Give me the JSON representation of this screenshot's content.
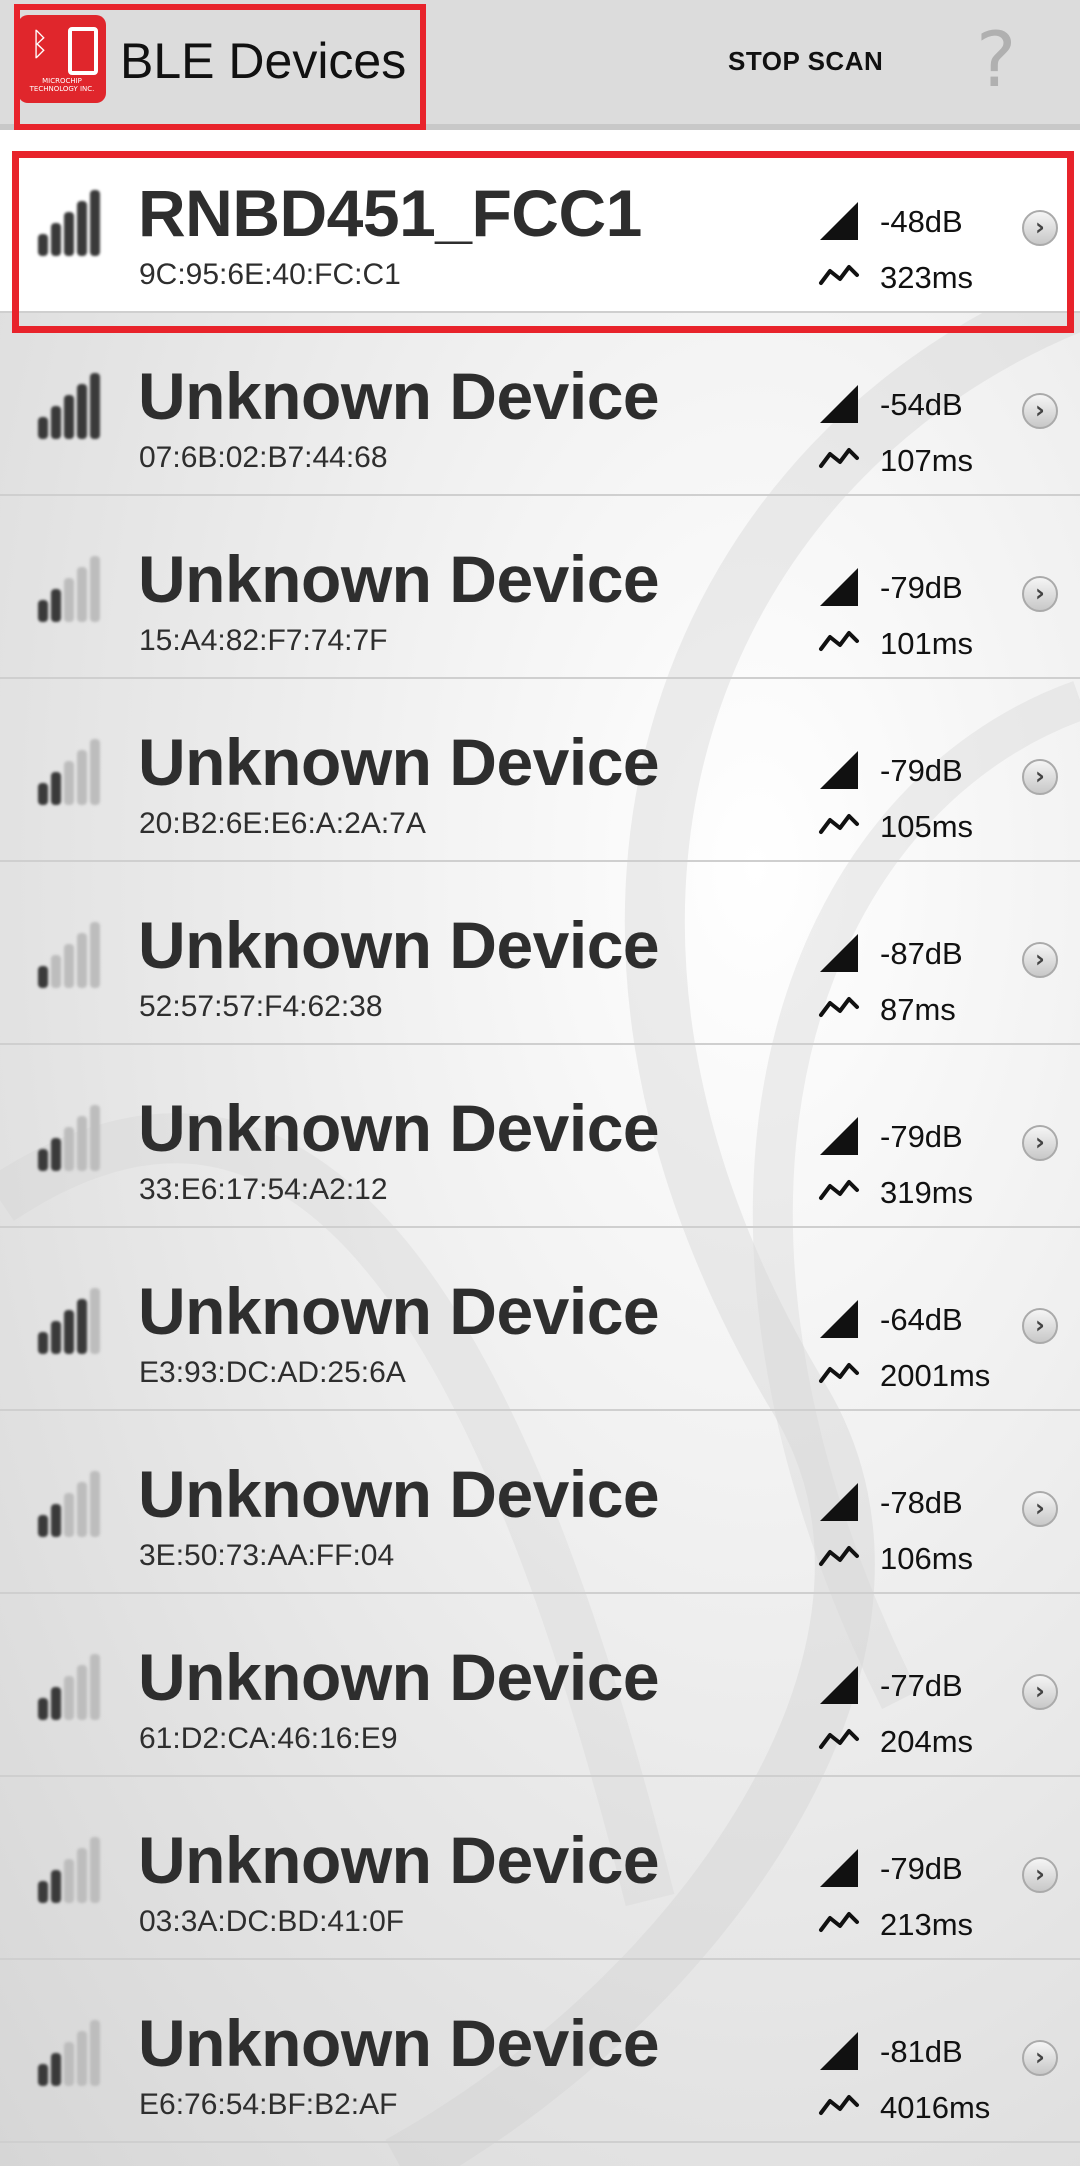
{
  "header": {
    "title": "BLE Devices",
    "logo_text": "MICROCHIP TECHNOLOGY INC.",
    "stop_scan_label": "STOP SCAN",
    "help_glyph": "?"
  },
  "devices": [
    {
      "name": "RNBD451_FCC1",
      "address": "9C:95:6E:40:FC:C1",
      "rssi": "-48dB",
      "interval": "323ms",
      "signal_bars": 5,
      "selected": true
    },
    {
      "name": "Unknown Device",
      "address": "07:6B:02:B7:44:68",
      "rssi": "-54dB",
      "interval": "107ms",
      "signal_bars": 5
    },
    {
      "name": "Unknown Device",
      "address": "15:A4:82:F7:74:7F",
      "rssi": "-79dB",
      "interval": "101ms",
      "signal_bars": 2
    },
    {
      "name": "Unknown Device",
      "address": "20:B2:6E:E6:A:2A:7A",
      "rssi": "-79dB",
      "interval": "105ms",
      "signal_bars": 2
    },
    {
      "name": "Unknown Device",
      "address": "52:57:57:F4:62:38",
      "rssi": "-87dB",
      "interval": "87ms",
      "signal_bars": 1
    },
    {
      "name": "Unknown Device",
      "address": "33:E6:17:54:A2:12",
      "rssi": "-79dB",
      "interval": "319ms",
      "signal_bars": 2
    },
    {
      "name": "Unknown Device",
      "address": "E3:93:DC:AD:25:6A",
      "rssi": "-64dB",
      "interval": "2001ms",
      "signal_bars": 4
    },
    {
      "name": "Unknown Device",
      "address": "3E:50:73:AA:FF:04",
      "rssi": "-78dB",
      "interval": "106ms",
      "signal_bars": 2
    },
    {
      "name": "Unknown Device",
      "address": "61:D2:CA:46:16:E9",
      "rssi": "-77dB",
      "interval": "204ms",
      "signal_bars": 2
    },
    {
      "name": "Unknown Device",
      "address": "03:3A:DC:BD:41:0F",
      "rssi": "-79dB",
      "interval": "213ms",
      "signal_bars": 2
    },
    {
      "name": "Unknown Device",
      "address": "E6:76:54:BF:B2:AF",
      "rssi": "-81dB",
      "interval": "4016ms",
      "signal_bars": 2
    }
  ],
  "colors": {
    "highlight": "#e8232b",
    "bar_active": "#3a3a3a",
    "bar_inactive": "#bdbdbd",
    "text_dark": "#2e2e2e"
  },
  "icons": {
    "rssi": "signal-triangle-icon",
    "interval": "zigzag-line-icon",
    "chevron": "chevron-right-circle-icon",
    "signal": "signal-bars-icon"
  }
}
